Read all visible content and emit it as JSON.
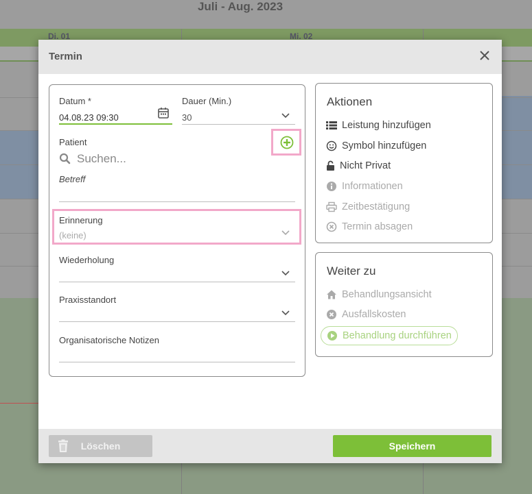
{
  "background": {
    "title": "Juli - Aug. 2023",
    "days": [
      "Di. 01",
      "Mi. 02"
    ]
  },
  "dialog": {
    "title": "Termin",
    "close_icon": "close-icon"
  },
  "form": {
    "datum_label": "Datum",
    "datum_required": "*",
    "datum_value": "04.08.23 09:30",
    "dauer_label": "Dauer (Min.)",
    "dauer_value": "30",
    "patient_label": "Patient",
    "patient_placeholder": "Suchen...",
    "betreff_placeholder": "Betreff",
    "erinnerung_label": "Erinnerung",
    "erinnerung_value": "(keine)",
    "wiederholung_label": "Wiederholung",
    "praxisstandort_label": "Praxisstandort",
    "notizen_label": "Organisatorische Notizen"
  },
  "aktionen": {
    "title": "Aktionen",
    "items": [
      {
        "label": "Leistung hinzufügen",
        "icon": "list-icon",
        "enabled": true
      },
      {
        "label": "Symbol hinzufügen",
        "icon": "smiley-icon",
        "enabled": true
      },
      {
        "label": "Nicht Privat",
        "icon": "unlock-icon",
        "enabled": true
      },
      {
        "label": "Informationen",
        "icon": "info-icon",
        "enabled": false
      },
      {
        "label": "Zeitbestätigung",
        "icon": "print-icon",
        "enabled": false
      },
      {
        "label": "Termin absagen",
        "icon": "cancel-circle-icon",
        "enabled": false
      }
    ]
  },
  "weiter": {
    "title": "Weiter zu",
    "items": [
      {
        "label": "Behandlungsansicht",
        "icon": "home-icon"
      },
      {
        "label": "Ausfallskosten",
        "icon": "cancel-circle-icon"
      },
      {
        "label": "Behandlung durchführen",
        "icon": "play-circle-icon"
      }
    ]
  },
  "footer": {
    "delete_label": "Löschen",
    "save_label": "Speichern"
  },
  "colors": {
    "accent_green": "#7dbf38",
    "highlight_pink": "#f2a8c9",
    "disabled_gray": "#aaaaaa"
  }
}
